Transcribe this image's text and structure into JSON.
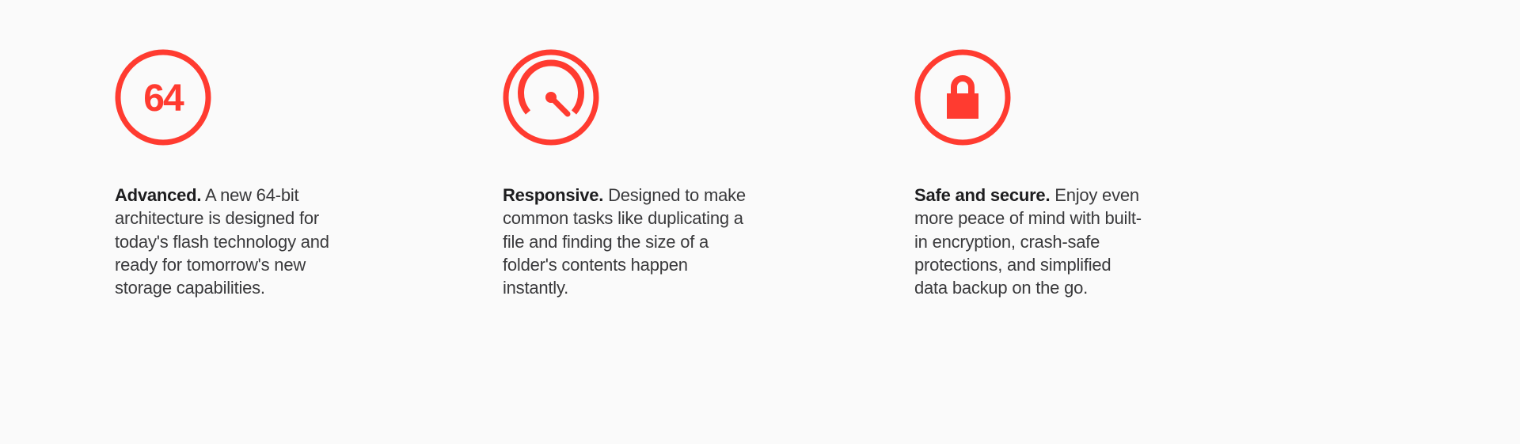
{
  "features": [
    {
      "title": "Advanced.",
      "description": " A new 64-bit architecture is designed for today's flash technology and ready for tomorrow's new storage capabilities.",
      "icon_label": "64"
    },
    {
      "title": "Responsive.",
      "description": " Designed to make common tasks like duplicating a file and finding the size of a folder's contents happen instantly."
    },
    {
      "title": "Safe and secure.",
      "description": " Enjoy even more peace of mind with built-in encryption, crash-safe protections, and simplified data backup on the go."
    }
  ]
}
